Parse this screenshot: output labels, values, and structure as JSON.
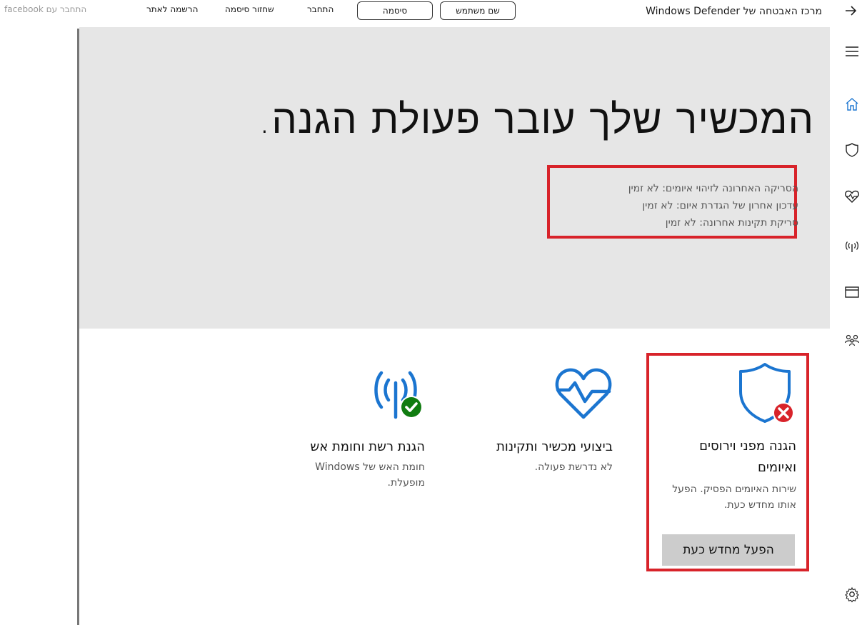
{
  "topbar": {
    "title": "מרכז האבטחה של Windows Defender",
    "username_placeholder": "שם משתמש",
    "password_placeholder": "סיסמה",
    "login_label": "התחבר",
    "recover_password_label": "שחזור סיסמה",
    "register_label": "הרשמה לאתר",
    "facebook_label": "התחבר עם facebook"
  },
  "hero": {
    "title": "המכשיר שלך עובר פעולת הגנה.",
    "scan_lines": [
      "הסריקה האחרונה לזיהוי איומים: לא זמין",
      "עדכון אחרון של הגדרת איום: לא זמין",
      "סריקת תקינות אחרונה: לא זמין"
    ]
  },
  "nav": {
    "icons": [
      "menu-icon",
      "home-icon",
      "shield-icon",
      "heart-health-icon",
      "network-icon",
      "browser-window-icon",
      "family-icon",
      "settings-gear-icon"
    ]
  },
  "tiles": {
    "virus": {
      "heading": "הגנה מפני וירוסים ואיומים",
      "description": "שירות האיומים הפסיק. הפעל אותו מחדש כעת.",
      "button": "הפעל מחדש כעת",
      "status": "error"
    },
    "performance": {
      "heading": "ביצועי מכשיר ותקינות",
      "description": "לא נדרשת פעולה.",
      "status": "ok"
    },
    "network": {
      "heading": "הגנת רשת וחומת אש",
      "description": "חומת האש של Windows מופעלת.",
      "status": "ok"
    }
  },
  "colors": {
    "accent_blue": "#1b75d0",
    "error_red": "#d8232a",
    "ok_green": "#107c10",
    "hero_bg": "#e6e6e6",
    "button_bg": "#cccccc"
  }
}
